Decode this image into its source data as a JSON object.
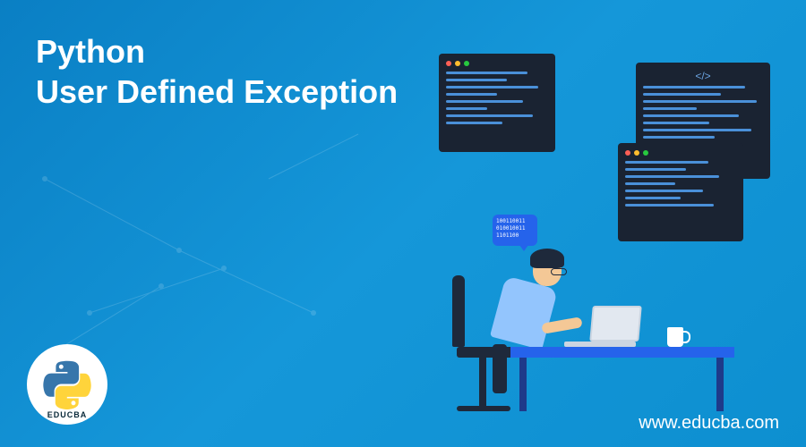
{
  "title_line1": "Python",
  "title_line2": "User Defined Exception",
  "website": "www.educba.com",
  "brand": "EDUCBA",
  "bubble_binary": "100110011\n010010011\n1101100",
  "code_tag": "</>",
  "colors": {
    "background_gradient_start": "#0a7fc4",
    "background_gradient_end": "#0d8fd0",
    "accent_blue": "#2563eb",
    "dark": "#1e293b"
  }
}
